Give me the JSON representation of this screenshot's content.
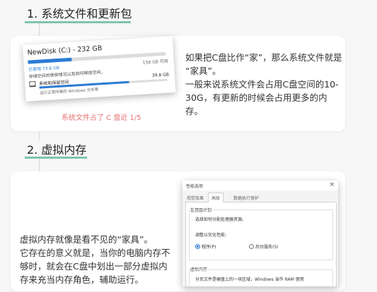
{
  "section1": {
    "heading": "1. 系统文件和更新包",
    "screenshot": {
      "disk_title": "NewDisk (C:) - 232 GB",
      "used_label": "已使用 73.6 GB",
      "free_label": "158 GB 可用",
      "desc": "存储空间的使用情况以及如何释放空间。",
      "item_label": "系统和保留空间",
      "item_size": "39.8 GB",
      "item_sub": "运行正常所需的 Windows 文件等",
      "used_fraction": 0.32,
      "item_fraction": 0.7
    },
    "caption": "系统文件占了 C 盘近 1/5",
    "text_lines": [
      "如果把C盘比作“家”，那么系统文件就是",
      "“家具”。",
      "一般来说系统文件会占用C盘空间的10-",
      "30G，有更新的时候会占用更多的内",
      "存。"
    ]
  },
  "section2": {
    "heading": "2. 虚拟内存",
    "dialog": {
      "title": "性能选项",
      "tabs": [
        "视觉效果",
        "高级",
        "数据执行保护"
      ],
      "group1_title": "处理器计划",
      "group1_desc": "选择如何分配处理器资源。",
      "adjust_label": "调整以优化性能:",
      "radio1": "程序(P)",
      "radio2": "后台服务(S)",
      "group2_title": "虚拟内存",
      "group2_desc": "分页文件是硬盘上的一块区域，Windows 当作 RAM 使用"
    },
    "text_lines": [
      "虚拟内存就像是看不见的“家具”。",
      "它存在的意义就是，当你的电脑内存不",
      "够时，就会在C盘中划出一部分虚拟内",
      "存来充当内存角色，辅助运行。"
    ]
  },
  "colors": {
    "accent": "#7fc4ad",
    "caption": "#e57373",
    "bar_blue": "#2b7cd3"
  }
}
